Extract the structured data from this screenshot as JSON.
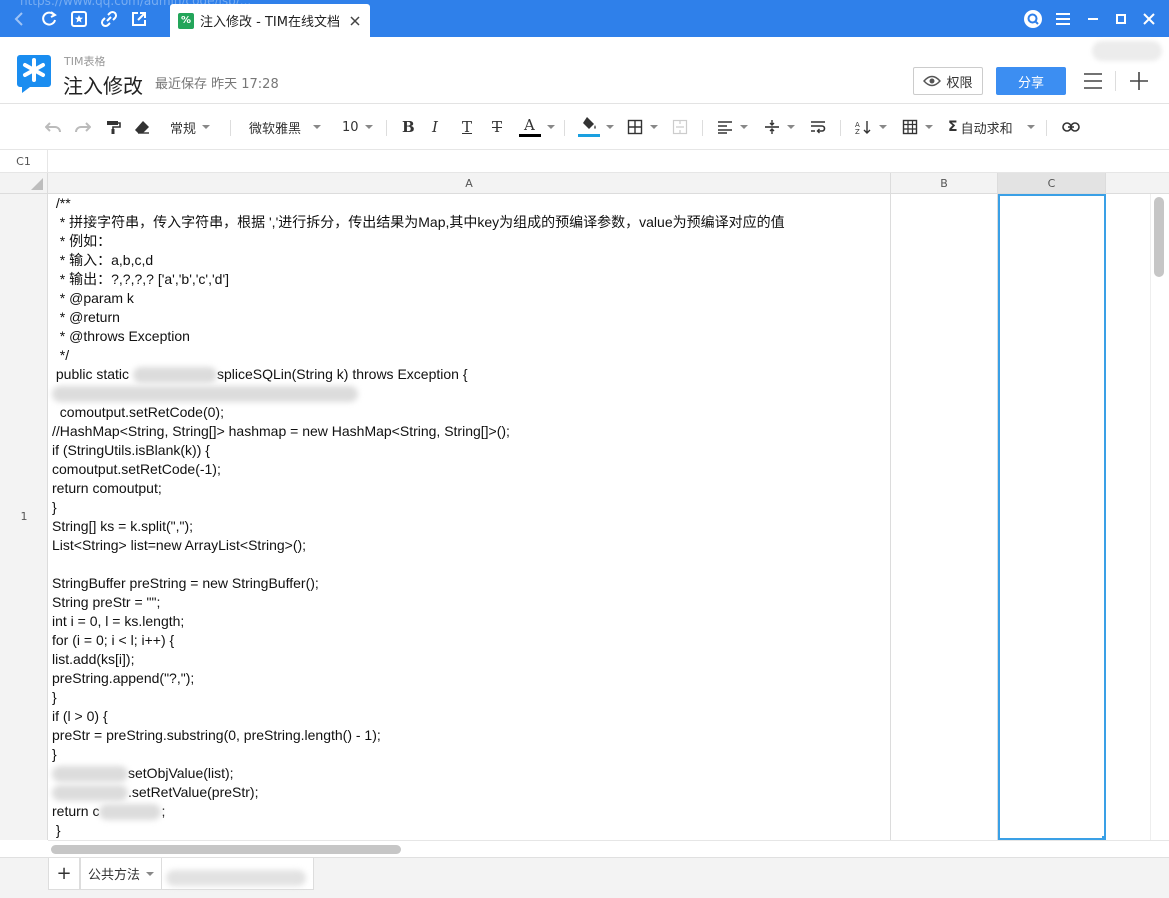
{
  "browser": {
    "url_ghost": "https://www.qq.com/admin/code/jsp/...",
    "tab_title": "注入修改 - TIM在线文档",
    "tab_favicon": "sheet-icon",
    "icons": [
      "back-icon",
      "refresh-icon",
      "bookmark-icon",
      "link-icon",
      "share-out-icon",
      "close-icon",
      "search-icon",
      "menu-icon",
      "minimize-icon",
      "maximize-icon",
      "window-close-icon"
    ]
  },
  "header": {
    "app_name": "TIM表格",
    "doc_title": "注入修改",
    "save_status": "最近保存 昨天 17:28",
    "permission_label": "权限",
    "share_label": "分享"
  },
  "toolbar": {
    "format_label": "常规",
    "font_label": "微软雅黑",
    "size_label": "10",
    "bold_label": "B",
    "italic_label": "I",
    "underline_label": "T",
    "strike_label": "T",
    "font_color_label": "A",
    "autosum_label": "自动求和",
    "accent_color": "#2f80ea",
    "font_color_bar": "#000000",
    "fill_color_bar": "#1aa0e0"
  },
  "formula_bar": {
    "cell_ref": "C1"
  },
  "grid": {
    "columns": [
      "A",
      "B",
      "C"
    ],
    "selected_column": "C",
    "rows": [
      "1"
    ],
    "selection_color": "#3aa0e6",
    "cell_a1_lines": [
      " /**",
      "  * 拼接字符串，传入字符串，根据 ','进行拆分，传出结果为Map,其中key为组成的预编译参数，value为预编译对应的值",
      "  * 例如：",
      "  * 输入：a,b,c,d",
      "  * 输出：?,?,?,? ['a','b','c','d']",
      "  * @param k",
      "  * @return",
      "  * @throws Exception",
      "  */",
      " public static ",
      "",
      "  comoutput.setRetCode(0);",
      "//HashMap<String, String[]> hashmap = new HashMap<String, String[]>();",
      "if (StringUtils.isBlank(k)) {",
      "comoutput.setRetCode(-1);",
      "return comoutput;",
      "}",
      "String[] ks = k.split(\",\");",
      "List<String> list=new ArrayList<String>();",
      "",
      "StringBuffer preString = new StringBuffer();",
      "String preStr = \"\";",
      "int i = 0, l = ks.length;",
      "for (i = 0; i < l; i++) {",
      "list.add(ks[i]);",
      "preString.append(\"?,\");",
      "}",
      "if (l > 0) {",
      "preStr = preString.substring(0, preString.length() - 1);",
      "}",
      "setObjValue(list);",
      ".setRetValue(preStr);",
      "return c",
      " }"
    ],
    "line10_suffix": "spliceSQLin(String k) throws Exception {",
    "line33_suffix": ";"
  },
  "sheets": {
    "add_label": "+",
    "active_sheet": "公共方法"
  }
}
